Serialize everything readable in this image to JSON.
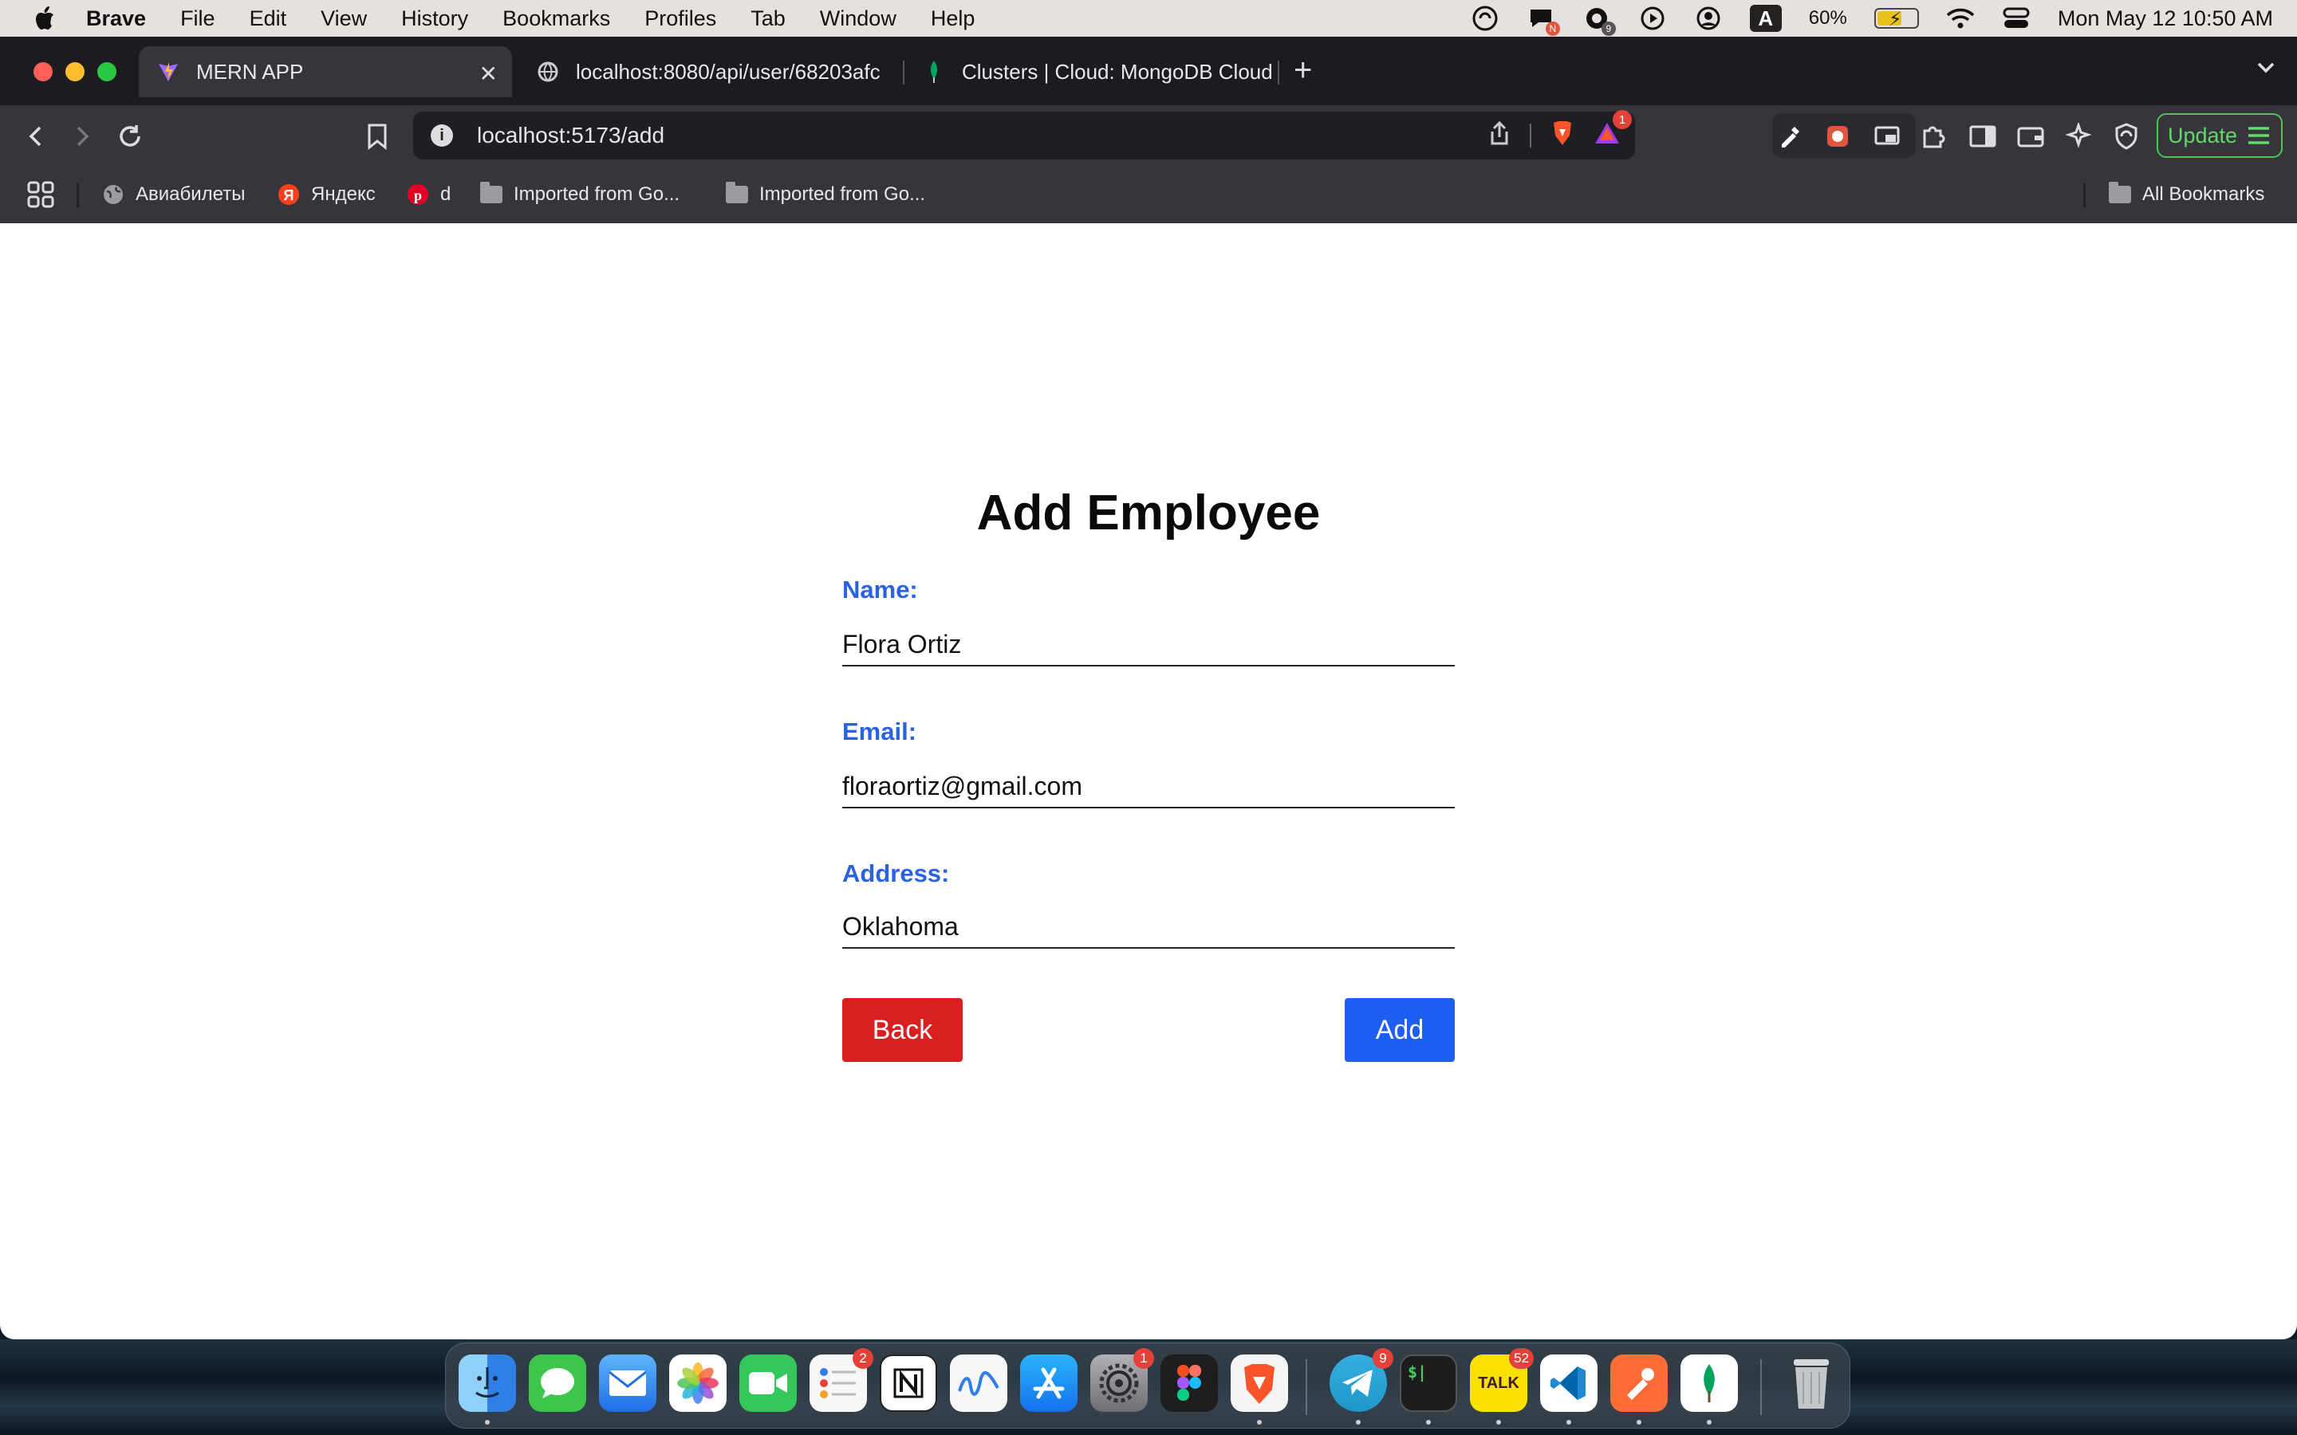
{
  "menubar": {
    "app_name": "Brave",
    "items": [
      "File",
      "Edit",
      "View",
      "History",
      "Bookmarks",
      "Profiles",
      "Tab",
      "Window",
      "Help"
    ],
    "battery_percent": "60%",
    "input_source": "A",
    "clock": "Mon May 12  10:50 AM",
    "status_icons": [
      "copilot-icon",
      "messenger-icon",
      "chatgpt-icon",
      "play-icon",
      "user-icon",
      "input-source-icon",
      "battery-icon",
      "wifi-icon",
      "control-center-icon"
    ],
    "badges": {
      "messenger": "N",
      "chatgpt": "9"
    }
  },
  "browser": {
    "tabs": [
      {
        "title": "MERN APP",
        "icon": "vite-icon",
        "active": true
      },
      {
        "title": "localhost:8080/api/user/68203afc",
        "icon": "globe-icon",
        "active": false
      },
      {
        "title": "Clusters | Cloud: MongoDB Cloud",
        "icon": "mongodb-leaf-icon",
        "active": false
      }
    ],
    "url": "localhost:5173/add",
    "brave_alert_count": "1",
    "update_label": "Update",
    "bookmarks": [
      {
        "label": "Авиабилеты",
        "icon": "globe-icon"
      },
      {
        "label": "Яндекс",
        "icon": "yandex-icon"
      },
      {
        "label": "d",
        "icon": "pinterest-icon"
      },
      {
        "label": "Imported from Go...",
        "icon": "folder-icon"
      },
      {
        "label": "Imported from Go...",
        "icon": "folder-icon"
      }
    ],
    "all_bookmarks_label": "All Bookmarks"
  },
  "form": {
    "title": "Add Employee",
    "name_label": "Name:",
    "name_value": "Flora Ortiz",
    "email_label": "Email:",
    "email_value": "floraortiz@gmail.com",
    "address_label": "Address:",
    "address_value": "Oklahoma",
    "back_label": "Back",
    "add_label": "Add",
    "colors": {
      "label": "#2a62e0",
      "back": "#d91f1f",
      "add": "#1f5ef3"
    }
  },
  "dock": {
    "apps": [
      {
        "name": "Finder",
        "icon": "finder-icon",
        "color": "#3a8df0"
      },
      {
        "name": "Messages",
        "icon": "messages-icon",
        "color": "#3cc64b"
      },
      {
        "name": "Mail",
        "icon": "mail-icon",
        "color": "#3b82f6"
      },
      {
        "name": "Photos",
        "icon": "photos-icon",
        "color": "#f1c232"
      },
      {
        "name": "FaceTime",
        "icon": "facetime-icon",
        "color": "#34c759"
      },
      {
        "name": "Reminders",
        "icon": "reminders-icon",
        "color": "#f5f5f5",
        "badge": "2"
      },
      {
        "name": "Notion",
        "icon": "notion-icon",
        "color": "#ffffff"
      },
      {
        "name": "Freeform",
        "icon": "freeform-icon",
        "color": "#f5f5f5"
      },
      {
        "name": "App Store",
        "icon": "app-store-icon",
        "color": "#1c8ef2"
      },
      {
        "name": "System Settings",
        "icon": "settings-icon",
        "color": "#8e8e93",
        "badge": "1"
      },
      {
        "name": "Figma",
        "icon": "figma-icon",
        "color": "#1e1e1e"
      },
      {
        "name": "Brave",
        "icon": "brave-icon",
        "color": "#f4f4f4"
      },
      {
        "name": "Telegram",
        "icon": "telegram-icon",
        "color": "#2ea6e0",
        "badge": "9"
      },
      {
        "name": "Terminal",
        "icon": "terminal-icon",
        "color": "#1d1d1d"
      },
      {
        "name": "KakaoTalk",
        "icon": "kakaotalk-icon",
        "color": "#fae100",
        "badge": "52"
      },
      {
        "name": "VS Code",
        "icon": "vscode-icon",
        "color": "#ffffff"
      },
      {
        "name": "Postman",
        "icon": "postman-icon",
        "color": "#ff6c37"
      },
      {
        "name": "MongoDB Compass",
        "icon": "mongodb-icon",
        "color": "#ffffff"
      },
      {
        "name": "Trash",
        "icon": "trash-icon",
        "color": "#cfd3d6"
      }
    ],
    "terminal_glyph": "$|",
    "kakao_glyph": "TALK"
  }
}
